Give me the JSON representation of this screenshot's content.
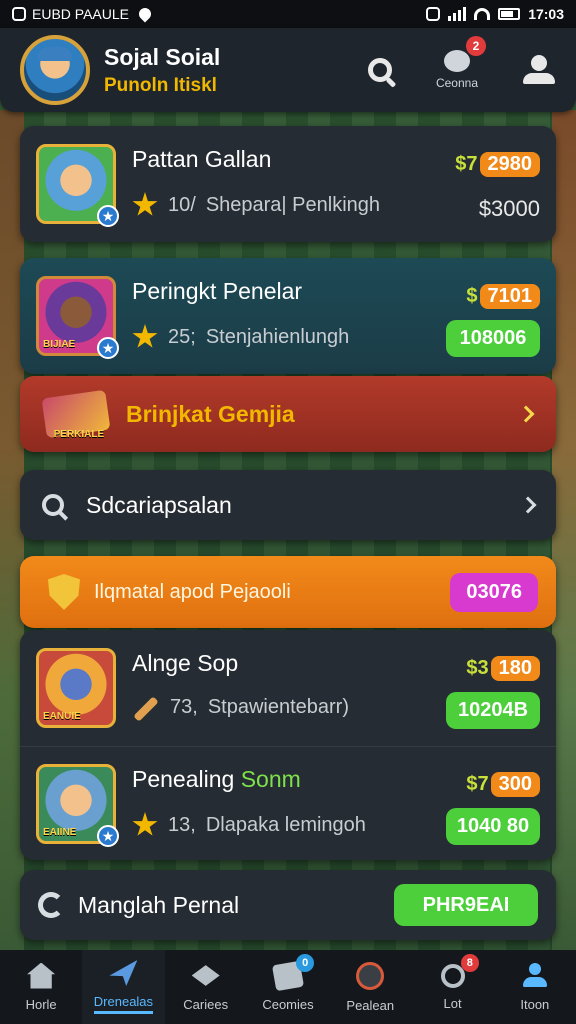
{
  "status_bar": {
    "app_label": "EUBD PAAULE",
    "time": "17:03"
  },
  "header": {
    "name": "Sojal Soial",
    "subtitle": "Punoln Itiskl",
    "chat_label": "Ceonna",
    "chat_badge": "2"
  },
  "games": [
    {
      "title": "Pattan Gallan",
      "title_accent": "",
      "icon_label": "",
      "rank": "10/",
      "sub": "Shepara| Penlkingh",
      "price_prefix": "$7",
      "price": "2980",
      "value": "$3000",
      "value_style": "plain"
    },
    {
      "title": "Peringkt Penelar",
      "title_accent": "",
      "icon_label": "BIJIAE",
      "rank": "25;",
      "sub": "Stenjahienlungh",
      "price_prefix": "$",
      "price": "7101",
      "value": "108006",
      "value_style": "green"
    },
    {
      "title": "Alnge Sop",
      "title_accent": "",
      "icon_label": "EANUIE",
      "rank": "73,",
      "sub": "Stpawientebarr)",
      "price_prefix": "$3",
      "price": "180",
      "value": "10204B",
      "value_style": "green"
    },
    {
      "title": "Penealing ",
      "title_accent": "Sonm",
      "icon_label": "EAIINE",
      "rank": "13,",
      "sub": "Dlapaka lemingoh",
      "price_prefix": "$7",
      "price": "300",
      "value": "1040 80",
      "value_style": "green"
    }
  ],
  "red_banner": {
    "badge_label": "PERKIALE",
    "title": "Brinjkat Gemjia"
  },
  "search_row": {
    "label": "Sdcariapsalan"
  },
  "orange_banner": {
    "title": "Ilqmatal apod Pejaooli",
    "pill": "03076"
  },
  "bottom_card": {
    "title": "Manglah Pernal",
    "button": "PHR9EAI"
  },
  "nav": [
    {
      "label": "Horle",
      "icon": "home-icon"
    },
    {
      "label": "Drenealas",
      "icon": "plane-icon"
    },
    {
      "label": "Cariees",
      "icon": "diamond-icon"
    },
    {
      "label": "Ceomies",
      "icon": "document-icon",
      "badge": "0"
    },
    {
      "label": "Pealean",
      "icon": "profile-circle-icon"
    },
    {
      "label": "Lot",
      "icon": "search-icon",
      "badge": "8"
    },
    {
      "label": "Itoon",
      "icon": "person-icon"
    }
  ],
  "colors": {
    "accent_yellow": "#f2b800",
    "green": "#4ccf3a",
    "orange": "#f28a1a",
    "red_banner": "#b23a2a",
    "pink_pill": "#d83ad0",
    "nav_active": "#5ab8ff"
  }
}
